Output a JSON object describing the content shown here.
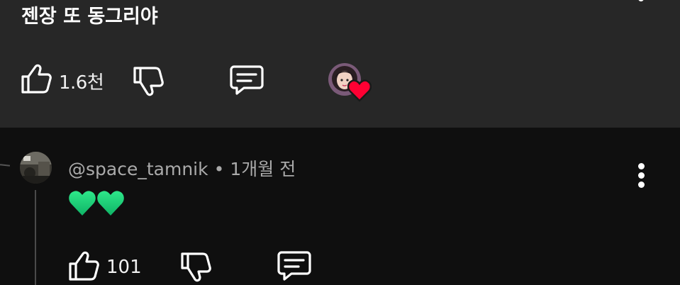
{
  "top_comment": {
    "text": "젠장 또 동그리야",
    "like_count": "1.6천",
    "icons": {
      "like": "thumbs-up-icon",
      "dislike": "thumbs-down-icon",
      "reply": "comment-icon",
      "creator_heart": "heart-icon",
      "more": "more-vert-icon"
    }
  },
  "reply": {
    "author": "@space_tamnik",
    "separator": "•",
    "time": "1개월 전",
    "text_emoji": "green-heart-icon x2",
    "like_count": "101",
    "icons": {
      "like": "thumbs-up-icon",
      "dislike": "thumbs-down-icon",
      "reply": "comment-icon",
      "more": "more-vert-icon"
    }
  },
  "colors": {
    "panel_bg": "#272727",
    "page_bg": "#0f0f0f",
    "secondary_text": "#aaaaaa",
    "heart_red": "#ff0033",
    "heart_green": "#1ed67a"
  }
}
